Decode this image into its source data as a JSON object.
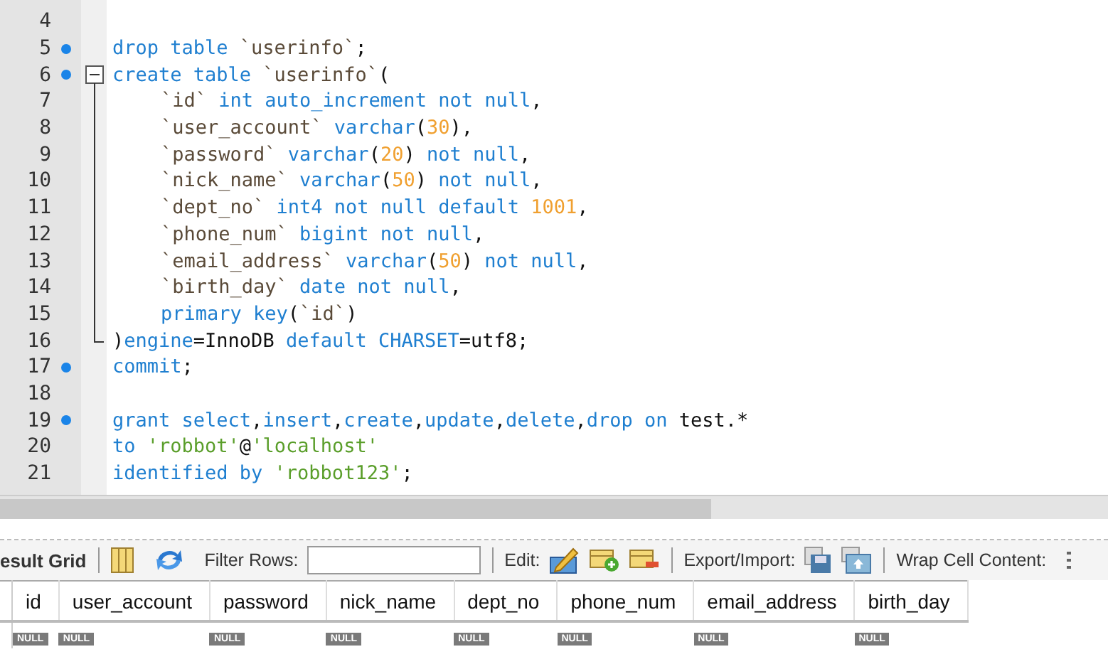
{
  "editor": {
    "lines": [
      {
        "number": "4",
        "marker": false,
        "kind": "plain"
      },
      {
        "number": "5",
        "marker": true,
        "kind": "plain",
        "tokens": [
          {
            "kind": "k",
            "text": "drop table "
          },
          {
            "kind": "i",
            "text": "`userinfo`"
          },
          {
            "kind": "p",
            "text": ";"
          }
        ]
      },
      {
        "number": "6",
        "marker": true,
        "kind": "fold-start",
        "tokens": [
          {
            "kind": "k",
            "text": "create table "
          },
          {
            "kind": "i",
            "text": "`userinfo`"
          },
          {
            "kind": "p",
            "text": "("
          }
        ]
      },
      {
        "number": "7",
        "marker": false,
        "kind": "fold-body",
        "indented": true,
        "tokens": [
          {
            "kind": "i",
            "text": "`id`"
          },
          {
            "kind": "k",
            "text": " int auto_increment not null"
          },
          {
            "kind": "p",
            "text": ","
          }
        ]
      },
      {
        "number": "8",
        "marker": false,
        "kind": "fold-body",
        "indented": true,
        "tokens": [
          {
            "kind": "i",
            "text": "`user_account`"
          },
          {
            "kind": "k",
            "text": " varchar"
          },
          {
            "kind": "p",
            "text": "("
          },
          {
            "kind": "n",
            "text": "30"
          },
          {
            "kind": "p",
            "text": "),"
          }
        ]
      },
      {
        "number": "9",
        "marker": false,
        "kind": "fold-body",
        "indented": true,
        "tokens": [
          {
            "kind": "i",
            "text": "`password`"
          },
          {
            "kind": "k",
            "text": " varchar"
          },
          {
            "kind": "p",
            "text": "("
          },
          {
            "kind": "n",
            "text": "20"
          },
          {
            "kind": "p",
            "text": ")"
          },
          {
            "kind": "k",
            "text": " not null"
          },
          {
            "kind": "p",
            "text": ","
          }
        ]
      },
      {
        "number": "10",
        "marker": false,
        "kind": "fold-body",
        "indented": true,
        "tokens": [
          {
            "kind": "i",
            "text": "`nick_name`"
          },
          {
            "kind": "k",
            "text": " varchar"
          },
          {
            "kind": "p",
            "text": "("
          },
          {
            "kind": "n",
            "text": "50"
          },
          {
            "kind": "p",
            "text": ")"
          },
          {
            "kind": "k",
            "text": " not null"
          },
          {
            "kind": "p",
            "text": ","
          }
        ]
      },
      {
        "number": "11",
        "marker": false,
        "kind": "fold-body",
        "indented": true,
        "tokens": [
          {
            "kind": "i",
            "text": "`dept_no`"
          },
          {
            "kind": "k",
            "text": " int4 not null default "
          },
          {
            "kind": "n",
            "text": "1001"
          },
          {
            "kind": "p",
            "text": ","
          }
        ]
      },
      {
        "number": "12",
        "marker": false,
        "kind": "fold-body",
        "indented": true,
        "tokens": [
          {
            "kind": "i",
            "text": "`phone_num`"
          },
          {
            "kind": "k",
            "text": " bigint not null"
          },
          {
            "kind": "p",
            "text": ","
          }
        ]
      },
      {
        "number": "13",
        "marker": false,
        "kind": "fold-body",
        "indented": true,
        "tokens": [
          {
            "kind": "i",
            "text": "`email_address`"
          },
          {
            "kind": "k",
            "text": " varchar"
          },
          {
            "kind": "p",
            "text": "("
          },
          {
            "kind": "n",
            "text": "50"
          },
          {
            "kind": "p",
            "text": ")"
          },
          {
            "kind": "k",
            "text": " not null"
          },
          {
            "kind": "p",
            "text": ","
          }
        ]
      },
      {
        "number": "14",
        "marker": false,
        "kind": "fold-body",
        "indented": true,
        "tokens": [
          {
            "kind": "i",
            "text": "`birth_day`"
          },
          {
            "kind": "k",
            "text": " date not null"
          },
          {
            "kind": "p",
            "text": ","
          }
        ]
      },
      {
        "number": "15",
        "marker": false,
        "kind": "fold-body",
        "indented": true,
        "tokens": [
          {
            "kind": "k",
            "text": "primary key"
          },
          {
            "kind": "p",
            "text": "("
          },
          {
            "kind": "i",
            "text": "`id`"
          },
          {
            "kind": "p",
            "text": ")"
          }
        ]
      },
      {
        "number": "16",
        "marker": false,
        "kind": "fold-end",
        "tokens": [
          {
            "kind": "p",
            "text": ")"
          },
          {
            "kind": "k",
            "text": "engine"
          },
          {
            "kind": "p",
            "text": "=InnoDB "
          },
          {
            "kind": "k",
            "text": "default CHARSET"
          },
          {
            "kind": "p",
            "text": "=utf8;"
          }
        ]
      },
      {
        "number": "17",
        "marker": true,
        "kind": "plain",
        "tokens": [
          {
            "kind": "k",
            "text": "commit"
          },
          {
            "kind": "p",
            "text": ";"
          }
        ]
      },
      {
        "number": "18",
        "marker": false,
        "kind": "plain"
      },
      {
        "number": "19",
        "marker": true,
        "kind": "plain",
        "tokens": [
          {
            "kind": "k",
            "text": "grant select"
          },
          {
            "kind": "p",
            "text": ","
          },
          {
            "kind": "k",
            "text": "insert"
          },
          {
            "kind": "p",
            "text": ","
          },
          {
            "kind": "k",
            "text": "create"
          },
          {
            "kind": "p",
            "text": ","
          },
          {
            "kind": "k",
            "text": "update"
          },
          {
            "kind": "p",
            "text": ","
          },
          {
            "kind": "k",
            "text": "delete"
          },
          {
            "kind": "p",
            "text": ","
          },
          {
            "kind": "k",
            "text": "drop on "
          },
          {
            "kind": "p",
            "text": "test.*"
          }
        ]
      },
      {
        "number": "20",
        "marker": false,
        "kind": "plain",
        "tokens": [
          {
            "kind": "k",
            "text": "to "
          },
          {
            "kind": "s",
            "text": "'robbot'"
          },
          {
            "kind": "p",
            "text": "@"
          },
          {
            "kind": "s",
            "text": "'localhost'"
          }
        ]
      },
      {
        "number": "21",
        "marker": false,
        "kind": "plain",
        "tokens": [
          {
            "kind": "k",
            "text": "identified by "
          },
          {
            "kind": "s",
            "text": "'robbot123'"
          },
          {
            "kind": "p",
            "text": ";"
          }
        ]
      }
    ]
  },
  "toolbar": {
    "result_tab": "esult Grid",
    "filter_label": "Filter Rows:",
    "edit_label": "Edit:",
    "export_label": "Export/Import:",
    "wrap_label": "Wrap Cell Content:"
  },
  "grid": {
    "columns": [
      "id",
      "user_account",
      "password",
      "nick_name",
      "dept_no",
      "phone_num",
      "email_address",
      "birth_day"
    ],
    "rows": [
      [
        "NULL",
        "NULL",
        "NULL",
        "NULL",
        "NULL",
        "NULL",
        "NULL",
        "NULL"
      ]
    ]
  }
}
